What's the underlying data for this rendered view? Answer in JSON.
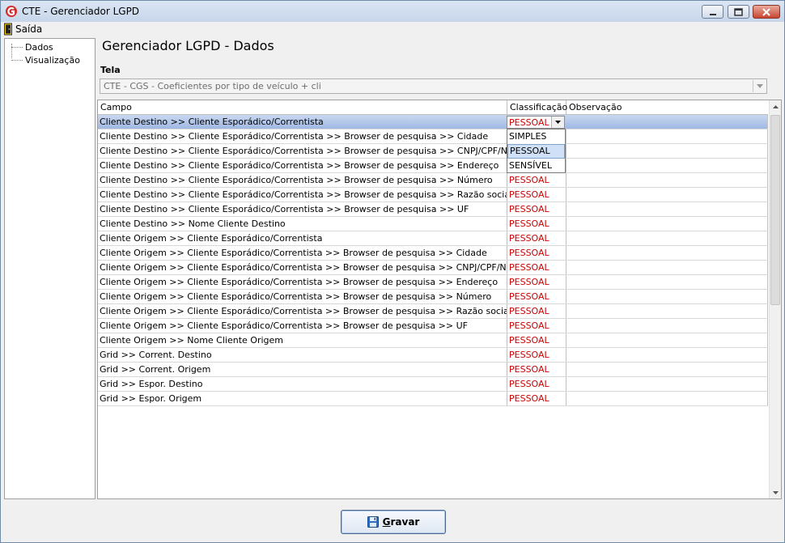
{
  "window": {
    "title": "CTE - Gerenciador LGPD"
  },
  "menu": {
    "exit_label": "Saída"
  },
  "sidebar": {
    "items": [
      {
        "label": "Dados"
      },
      {
        "label": "Visualização"
      }
    ]
  },
  "page": {
    "title": "Gerenciador LGPD - Dados",
    "tela_label": "Tela",
    "tela_value": "CTE - CGS - Coeficientes por tipo de veículo + cli"
  },
  "grid": {
    "columns": [
      "Campo",
      "Classificação",
      "Observação"
    ],
    "rows": [
      {
        "campo": "Cliente Destino >> Cliente Esporádico/Correntista",
        "classificacao": "PESSOAL",
        "observacao": ""
      },
      {
        "campo": "Cliente Destino >> Cliente Esporádico/Correntista >> Browser de pesquisa >> Cidade",
        "classificacao": "",
        "observacao": ""
      },
      {
        "campo": "Cliente Destino >> Cliente Esporádico/Correntista >> Browser de pesquisa >> CNPJ/CPF/Nr.Cliente",
        "classificacao": "",
        "observacao": ""
      },
      {
        "campo": "Cliente Destino >> Cliente Esporádico/Correntista >> Browser de pesquisa >> Endereço",
        "classificacao": "",
        "observacao": ""
      },
      {
        "campo": "Cliente Destino >> Cliente Esporádico/Correntista >> Browser de pesquisa >> Número",
        "classificacao": "PESSOAL",
        "observacao": ""
      },
      {
        "campo": "Cliente Destino >> Cliente Esporádico/Correntista >> Browser de pesquisa >> Razão social",
        "classificacao": "PESSOAL",
        "observacao": ""
      },
      {
        "campo": "Cliente Destino >> Cliente Esporádico/Correntista >> Browser de pesquisa >> UF",
        "classificacao": "PESSOAL",
        "observacao": ""
      },
      {
        "campo": "Cliente Destino >> Nome Cliente Destino",
        "classificacao": "PESSOAL",
        "observacao": ""
      },
      {
        "campo": "Cliente Origem >> Cliente Esporádico/Correntista",
        "classificacao": "PESSOAL",
        "observacao": ""
      },
      {
        "campo": "Cliente Origem >> Cliente Esporádico/Correntista >> Browser de pesquisa >> Cidade",
        "classificacao": "PESSOAL",
        "observacao": ""
      },
      {
        "campo": "Cliente Origem >> Cliente Esporádico/Correntista >> Browser de pesquisa >> CNPJ/CPF/Nr.Cliente",
        "classificacao": "PESSOAL",
        "observacao": ""
      },
      {
        "campo": "Cliente Origem >> Cliente Esporádico/Correntista >> Browser de pesquisa >> Endereço",
        "classificacao": "PESSOAL",
        "observacao": ""
      },
      {
        "campo": "Cliente Origem >> Cliente Esporádico/Correntista >> Browser de pesquisa >> Número",
        "classificacao": "PESSOAL",
        "observacao": ""
      },
      {
        "campo": "Cliente Origem >> Cliente Esporádico/Correntista >> Browser de pesquisa >> Razão social",
        "classificacao": "PESSOAL",
        "observacao": ""
      },
      {
        "campo": "Cliente Origem >> Cliente Esporádico/Correntista >> Browser de pesquisa >> UF",
        "classificacao": "PESSOAL",
        "observacao": ""
      },
      {
        "campo": "Cliente Origem >> Nome Cliente Origem",
        "classificacao": "PESSOAL",
        "observacao": ""
      },
      {
        "campo": "Grid >> Corrent. Destino",
        "classificacao": "PESSOAL",
        "observacao": ""
      },
      {
        "campo": "Grid >> Corrent. Origem",
        "classificacao": "PESSOAL",
        "observacao": ""
      },
      {
        "campo": "Grid >> Espor. Destino",
        "classificacao": "PESSOAL",
        "observacao": ""
      },
      {
        "campo": "Grid >> Espor. Origem",
        "classificacao": "PESSOAL",
        "observacao": ""
      }
    ],
    "selected_row": 0
  },
  "dropdown": {
    "options": [
      "SIMPLES",
      "PESSOAL",
      "SENSÍVEL"
    ],
    "highlighted": 1
  },
  "footer": {
    "save_label_first": "G",
    "save_label_rest": "ravar"
  },
  "colors": {
    "classification_text": "#cc0000",
    "selected_row": "#9fb8e3"
  },
  "icons": {
    "app": "app-logo-icon",
    "exit": "exit-door-icon",
    "save": "floppy-disk-icon"
  }
}
